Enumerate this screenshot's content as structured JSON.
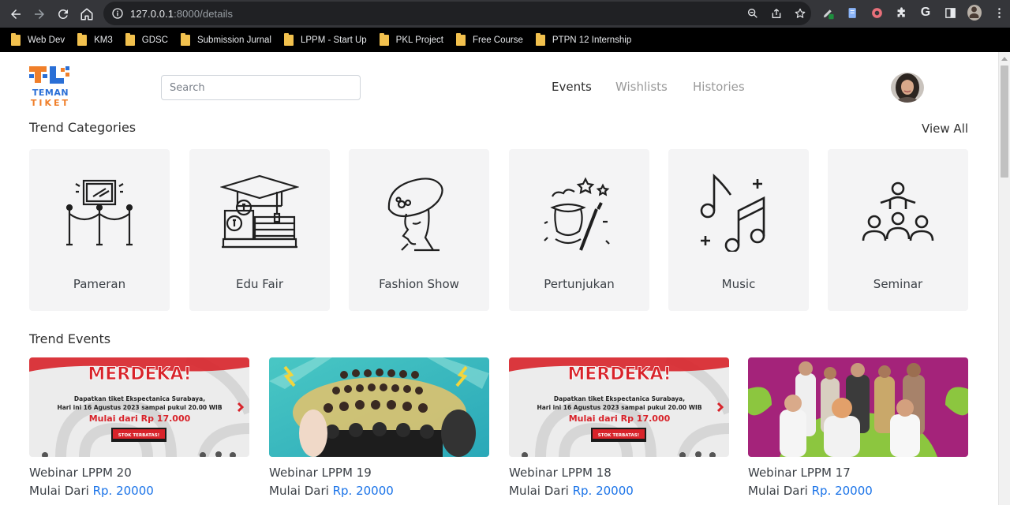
{
  "browser": {
    "url_host": "127.0.0.1",
    "url_rest": ":8000/details",
    "bookmarks": [
      "Web Dev",
      "KM3",
      "GDSC",
      "Submission Jurnal",
      "LPPM - Start Up",
      "PKL Project",
      "Free Course",
      "PTPN 12 Internship"
    ]
  },
  "header": {
    "logo_line1": "TEMAN",
    "logo_line2": "TIKET",
    "search_placeholder": "Search",
    "nav": [
      "Events",
      "Wishlists",
      "Histories"
    ]
  },
  "categories": {
    "title": "Trend Categories",
    "view_all": "View All",
    "items": [
      {
        "label": "Pameran",
        "icon": "exhibition-icon"
      },
      {
        "label": "Edu Fair",
        "icon": "graduation-cap-icon"
      },
      {
        "label": "Fashion Show",
        "icon": "fashion-hat-icon"
      },
      {
        "label": "Pertunjukan",
        "icon": "magic-hat-icon"
      },
      {
        "label": "Music",
        "icon": "music-notes-icon"
      },
      {
        "label": "Seminar",
        "icon": "audience-icon"
      }
    ]
  },
  "events": {
    "title": "Trend Events",
    "price_prefix": "Mulai Dari",
    "items": [
      {
        "title": "Webinar LPPM 20",
        "price": "Rp. 20000",
        "banner_heading": "MERDEKA!",
        "banner_line1": "Dapatkan tiket Ekspectanica Surabaya,",
        "banner_line2": "Hari ini 16 Agustus 2023 sampai pukul 20.00 WIB",
        "banner_offer": "Mulai dari Rp 17.000",
        "banner_badge": "STOK TERBATAS!"
      },
      {
        "title": "Webinar LPPM 19",
        "price": "Rp. 20000"
      },
      {
        "title": "Webinar LPPM 18",
        "price": "Rp. 20000",
        "banner_heading": "MERDEKA!",
        "banner_line1": "Dapatkan tiket Ekspectanica Surabaya,",
        "banner_line2": "Hari ini 16 Agustus 2023 sampai pukul 20.00 WIB",
        "banner_offer": "Mulai dari Rp 17.000",
        "banner_badge": "STOK TERBATAS!"
      },
      {
        "title": "Webinar LPPM 17",
        "price": "Rp. 20000"
      }
    ]
  }
}
